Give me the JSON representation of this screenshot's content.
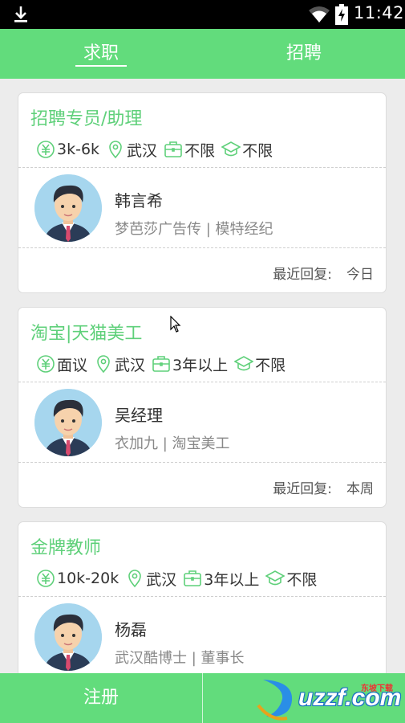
{
  "status_bar": {
    "time": "11:42",
    "icons": [
      "download-icon",
      "wifi-icon",
      "battery-charging-icon"
    ]
  },
  "tabs": {
    "left_label": "求职",
    "right_label": "招聘",
    "active": "求职"
  },
  "jobs": [
    {
      "title": "招聘专员/助理",
      "salary": "3k-6k",
      "location": "武汉",
      "experience": "不限",
      "education": "不限",
      "recruiter_name": "韩言希",
      "company": "梦芭莎广告传 | 模特经纪",
      "reply_label": "最近回复:",
      "reply_value": "今日"
    },
    {
      "title": "淘宝|天猫美工",
      "salary": "面议",
      "location": "武汉",
      "experience": "3年以上",
      "education": "不限",
      "recruiter_name": "吴经理",
      "company": "衣加九 | 淘宝美工",
      "reply_label": "最近回复:",
      "reply_value": "本周"
    },
    {
      "title": "金牌教师",
      "salary": "10k-20k",
      "location": "武汉",
      "experience": "3年以上",
      "education": "不限",
      "recruiter_name": "杨磊",
      "company": "武汉酷博士 | 董事长",
      "reply_label": "",
      "reply_value": ""
    }
  ],
  "bottom_bar": {
    "left_label": "注册",
    "right_label": ""
  },
  "watermark": {
    "text": "uzzf.com",
    "small_text": "东坡下载"
  },
  "colors": {
    "accent": "#62dc7c",
    "title_green": "#5fd07a",
    "background": "#ececec"
  }
}
